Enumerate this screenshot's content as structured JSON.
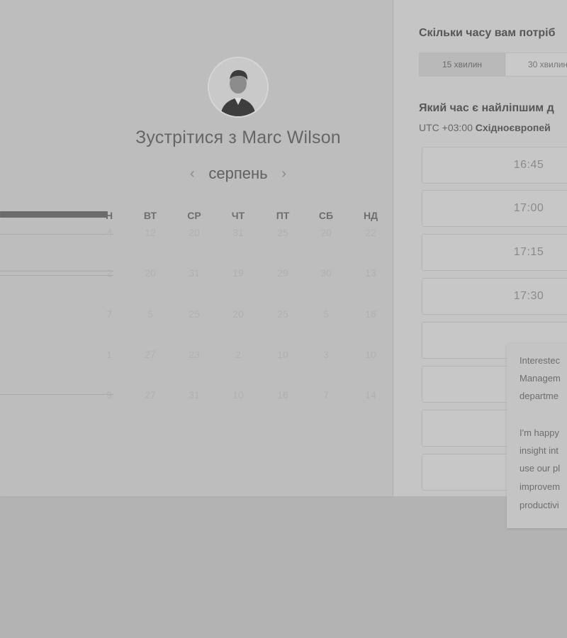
{
  "profile": {
    "meet_title": "Зустрітися з Marc Wilson"
  },
  "calendar": {
    "month": "серпень",
    "prev_icon": "chevron-left-icon",
    "next_icon": "chevron-right-icon",
    "weekdays": [
      "Н",
      "ВТ",
      "СР",
      "ЧТ",
      "ПТ",
      "СБ",
      "НД"
    ],
    "rows": [
      [
        "4",
        "12",
        "20",
        "31",
        "25",
        "20",
        "22"
      ],
      [
        "2",
        "20",
        "31",
        "19",
        "29",
        "30",
        "13"
      ],
      [
        "7",
        "5",
        "25",
        "20",
        "25",
        "5",
        "16"
      ],
      [
        "1",
        "27",
        "23",
        "2",
        "10",
        "3",
        "10"
      ],
      [
        "9",
        "27",
        "31",
        "10",
        "16",
        "7",
        "14"
      ]
    ]
  },
  "booking": {
    "duration_question": "Скільки часу вам потріб",
    "durations": [
      "15 хвилин",
      "30 хвилин"
    ],
    "selected_duration": "15 хвилин",
    "time_question": "Який час є найліпшим д",
    "timezone_offset": "UTC +03:00",
    "timezone_name": "Східноєвропей",
    "slots": [
      "16:45",
      "17:00",
      "17:15",
      "17:30",
      "",
      "",
      "",
      ""
    ]
  },
  "popup": {
    "lines": [
      "Interestec",
      "Managem",
      "departme",
      "",
      "I'm happy",
      "insight int",
      "use our pl",
      "improvem",
      "productivi"
    ]
  },
  "colors": {
    "overlay_background": "#b3b3b3",
    "left_panel": "#bdbdbd",
    "right_panel": "#c5c5c5"
  }
}
